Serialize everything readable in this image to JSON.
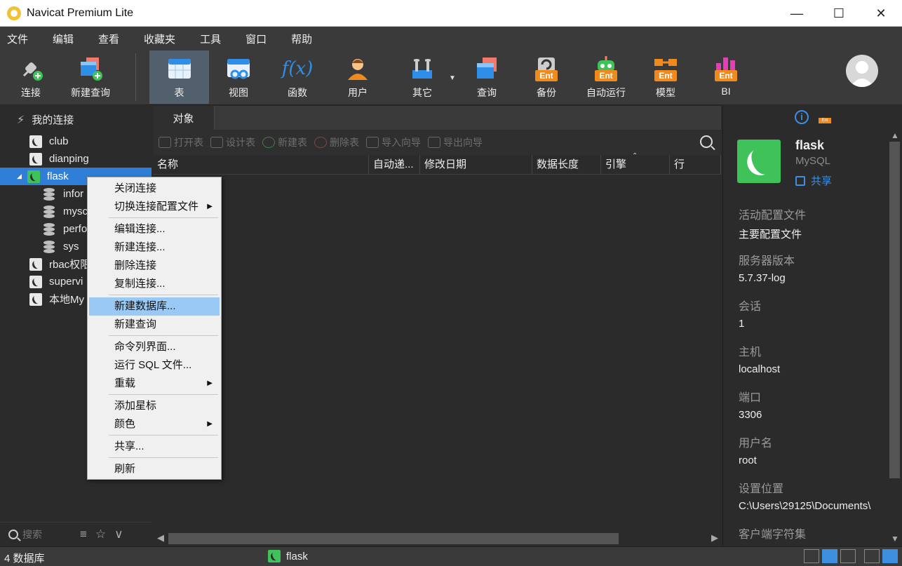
{
  "window": {
    "title": "Navicat Premium Lite"
  },
  "menubar": [
    "文件",
    "编辑",
    "查看",
    "收藏夹",
    "工具",
    "窗口",
    "帮助"
  ],
  "toolbar": {
    "connect": "连接",
    "new_query": "新建查询",
    "table": "表",
    "view": "视图",
    "function": "函数",
    "user": "用户",
    "other": "其它",
    "query": "查询",
    "backup": "备份",
    "automation": "自动运行",
    "model": "模型",
    "bi": "BI",
    "ent_badge": "Ent",
    "function_glyph": "f(x)"
  },
  "sidebar": {
    "root": "我的连接",
    "items": [
      {
        "label": "club"
      },
      {
        "label": "dianping"
      },
      {
        "label": "flask"
      },
      {
        "label": "infor"
      },
      {
        "label": "mysc"
      },
      {
        "label": "perfo"
      },
      {
        "label": "sys"
      },
      {
        "label": "rbac权限"
      },
      {
        "label": "supervi"
      },
      {
        "label": "本地My"
      }
    ],
    "search_placeholder": "搜索"
  },
  "center": {
    "tab": "对象",
    "actions": {
      "open_table": "打开表",
      "design_table": "设计表",
      "new_table": "新建表",
      "delete_table": "删除表",
      "import_wizard": "导入向导",
      "export_wizard": "导出向导"
    },
    "columns": [
      "名称",
      "自动递...",
      "修改日期",
      "数据长度",
      "引擎",
      "行"
    ]
  },
  "context_menu": {
    "close_connection": "关闭连接",
    "switch_profile": "切换连接配置文件",
    "edit_connection": "编辑连接...",
    "new_connection": "新建连接...",
    "delete_connection": "删除连接",
    "copy_connection": "复制连接...",
    "new_database": "新建数据库...",
    "new_query": "新建查询",
    "console": "命令列界面...",
    "run_sql": "运行 SQL 文件...",
    "reload": "重载",
    "add_star": "添加星标",
    "color": "颜色",
    "share": "共享...",
    "refresh": "刷新"
  },
  "info": {
    "name": "flask",
    "type": "MySQL",
    "share": "共享",
    "fields": [
      {
        "key": "活动配置文件",
        "value": "主要配置文件"
      },
      {
        "key": "服务器版本",
        "value": "5.7.37-log"
      },
      {
        "key": "会话",
        "value": "1"
      },
      {
        "key": "主机",
        "value": "localhost"
      },
      {
        "key": "端口",
        "value": "3306"
      },
      {
        "key": "用户名",
        "value": "root"
      },
      {
        "key": "设置位置",
        "value": "C:\\Users\\29125\\Documents\\"
      },
      {
        "key": "客户端字符集",
        "value": ""
      }
    ]
  },
  "status": {
    "db_count": "4 数据库",
    "current": "flask"
  },
  "colors": {
    "accent": "#2f7fd8",
    "mysql_green": "#3fc25a",
    "ent_orange": "#f08a1c",
    "menu_hover": "#99c9f4"
  }
}
